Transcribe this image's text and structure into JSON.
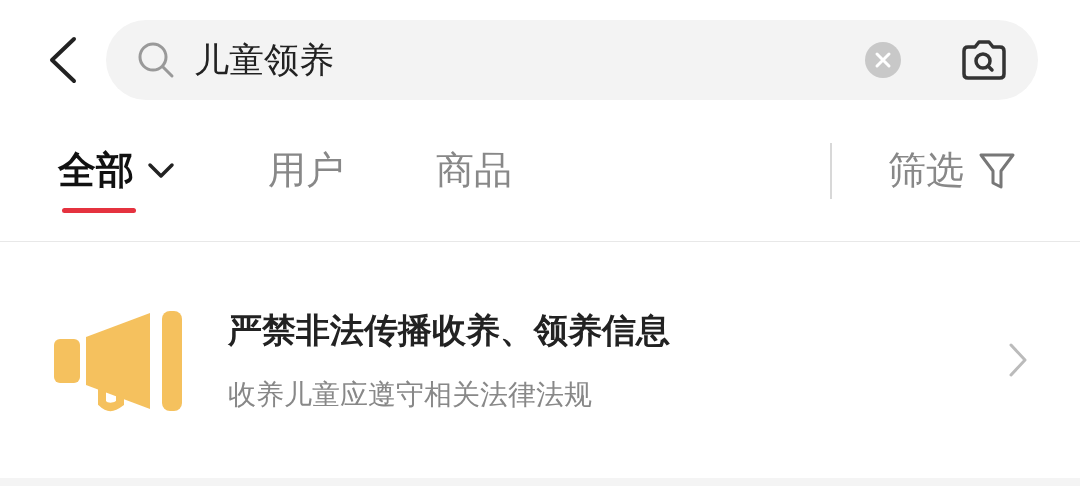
{
  "search": {
    "value": "儿童领养"
  },
  "tabs": [
    {
      "label": "全部",
      "selected": true,
      "kind": "dropdown"
    },
    {
      "label": "用户",
      "selected": false,
      "kind": "plain"
    },
    {
      "label": "商品",
      "selected": false,
      "kind": "plain"
    }
  ],
  "filter": {
    "label": "筛选"
  },
  "notice": {
    "title": "严禁非法传播收养、领养信息",
    "subtitle": "收养儿童应遵守相关法律法规"
  }
}
